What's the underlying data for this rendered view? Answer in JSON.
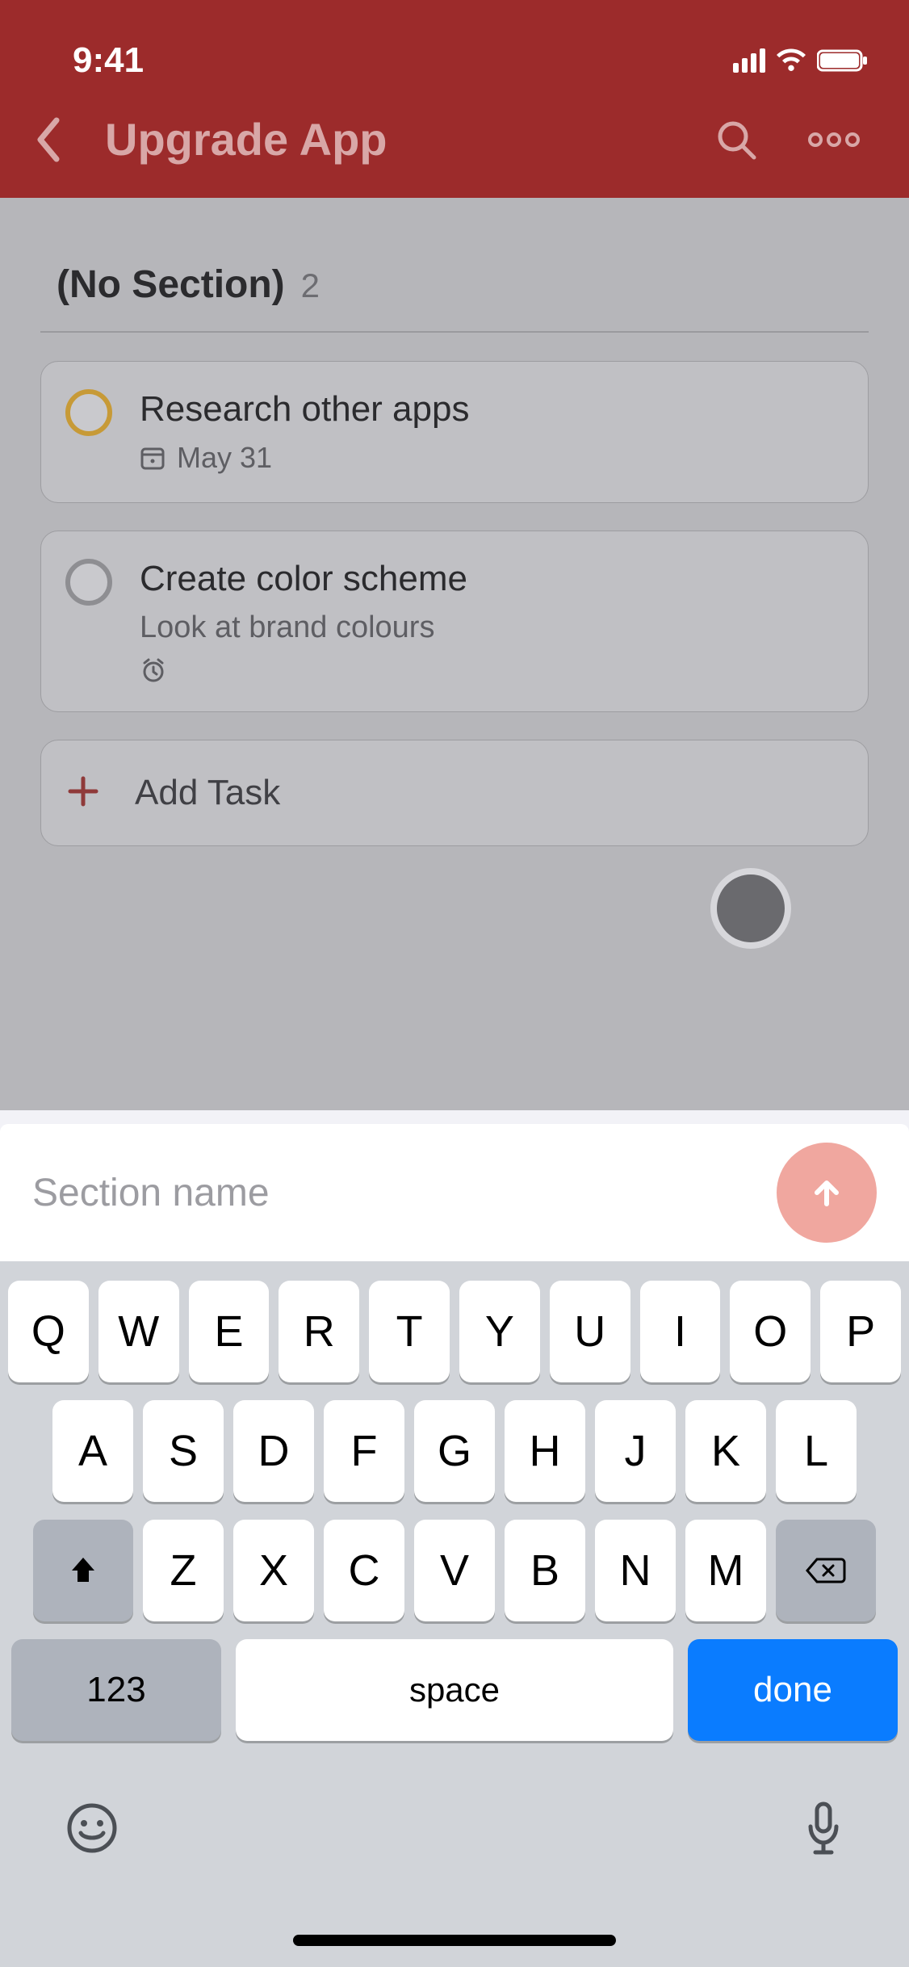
{
  "status": {
    "time": "9:41"
  },
  "header": {
    "title": "Upgrade App"
  },
  "section": {
    "title": "(No Section)",
    "count": "2"
  },
  "tasks": [
    {
      "title": "Research other apps",
      "date": "May 31"
    },
    {
      "title": "Create color scheme",
      "subtitle": "Look at brand colours"
    }
  ],
  "add_task_label": "Add Task",
  "sheet": {
    "placeholder": "Section name"
  },
  "keyboard": {
    "row1": [
      "Q",
      "W",
      "E",
      "R",
      "T",
      "Y",
      "U",
      "I",
      "O",
      "P"
    ],
    "row2": [
      "A",
      "S",
      "D",
      "F",
      "G",
      "H",
      "J",
      "K",
      "L"
    ],
    "row3": [
      "Z",
      "X",
      "C",
      "V",
      "B",
      "N",
      "M"
    ],
    "numbers": "123",
    "space": "space",
    "done": "done"
  }
}
